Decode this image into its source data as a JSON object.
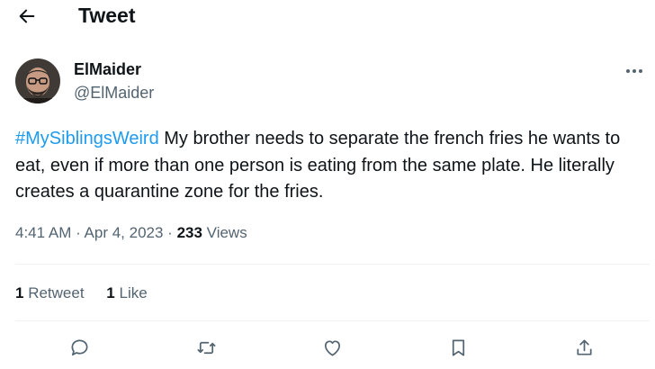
{
  "header": {
    "title": "Tweet",
    "back_icon": "arrow-left-icon"
  },
  "author": {
    "display_name": "ElMaider",
    "handle": "@ElMaider"
  },
  "more_icon": "more-horizontal-icon",
  "tweet": {
    "hashtag": "#MySiblingsWeird",
    "text": " My brother needs to separate the french fries he wants to eat, even if more than one person is eating from the same plate. He literally creates a quarantine zone for the fries."
  },
  "meta": {
    "time": "4:41 AM",
    "separator": " · ",
    "date": "Apr 4, 2023",
    "views_count": "233",
    "views_label": " Views"
  },
  "stats": {
    "retweets_count": "1",
    "retweets_label": " Retweet",
    "likes_count": "1",
    "likes_label": " Like"
  },
  "actions": [
    {
      "name": "reply",
      "icon": "reply-icon"
    },
    {
      "name": "retweet",
      "icon": "retweet-icon"
    },
    {
      "name": "like",
      "icon": "heart-icon"
    },
    {
      "name": "bookmark",
      "icon": "bookmark-icon"
    },
    {
      "name": "share",
      "icon": "share-icon"
    }
  ],
  "colors": {
    "text": "#0f1419",
    "secondary": "#536471",
    "link": "#1d9bf0",
    "divider": "#eff3f4"
  }
}
